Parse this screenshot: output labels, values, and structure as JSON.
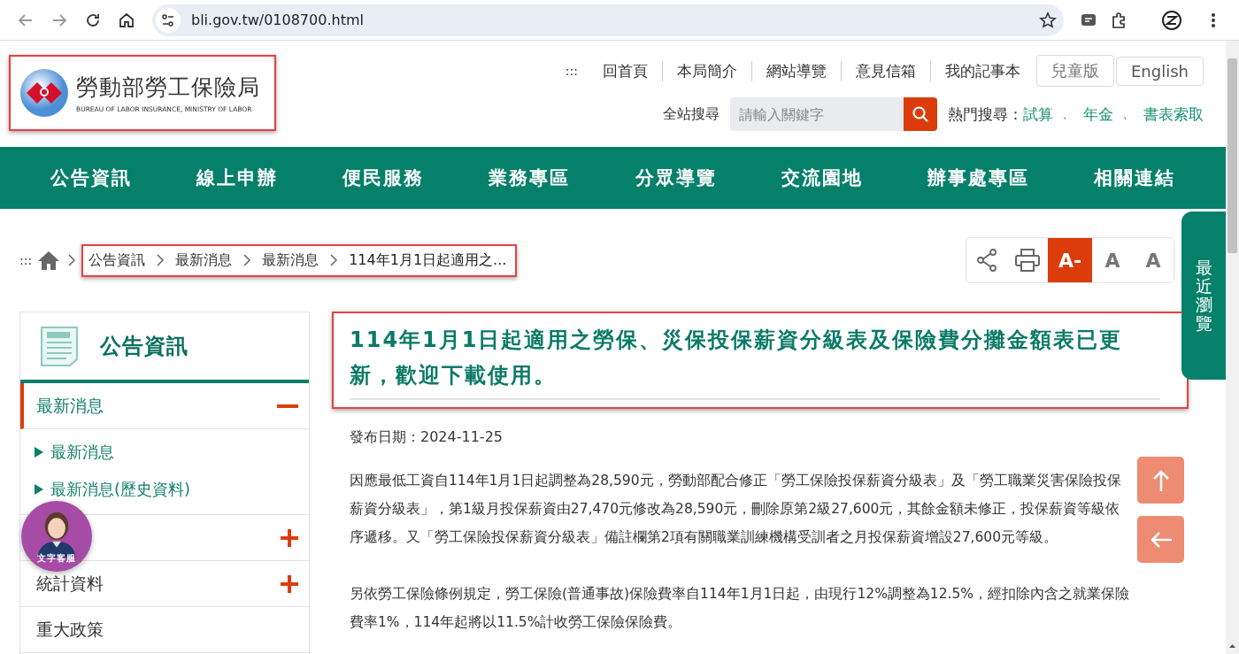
{
  "browser": {
    "url": "bli.gov.tw/0108700.html"
  },
  "logo": {
    "title": "勞動部勞工保險局",
    "subtitle": "BUREAU OF LABOR INSURANCE, MINISTRY OF LABOR"
  },
  "top_links": {
    "accesskey": ":::",
    "items": [
      "回首頁",
      "本局簡介",
      "網站導覽",
      "意見信箱",
      "我的記事本"
    ]
  },
  "top_buttons": [
    "兒童版",
    "English"
  ],
  "search": {
    "label": "全站搜尋",
    "placeholder": "請輸入關鍵字"
  },
  "hot_search": {
    "label": "熱門搜尋：",
    "links": [
      "試算",
      "年金",
      "書表索取"
    ],
    "separators": [
      "、",
      "、"
    ]
  },
  "nav": [
    "公告資訊",
    "線上申辦",
    "便民服務",
    "業務專區",
    "分眾導覽",
    "交流園地",
    "辦事處專區",
    "相關連結"
  ],
  "breadcrumb": {
    "accesskey": ":::",
    "items": [
      "公告資訊",
      "最新消息",
      "最新消息",
      "114年1月1日起適用之..."
    ]
  },
  "tools": [
    {
      "kind": "share"
    },
    {
      "kind": "print"
    },
    {
      "kind": "font",
      "label": "A-",
      "selected": true
    },
    {
      "kind": "font",
      "label": "A",
      "selected": false
    },
    {
      "kind": "font",
      "label": "A",
      "selected": false
    }
  ],
  "recent_tab": "最近瀏覽",
  "sidebar": {
    "title": "公告資訊",
    "items": [
      {
        "label": "最新消息",
        "selected": true,
        "expanded": true,
        "children": [
          {
            "label": "最新消息"
          },
          {
            "label": "最新消息(歷史資料)"
          }
        ]
      },
      {
        "selected": false,
        "expanded": false
      },
      {
        "label": "統計資料",
        "selected": false,
        "expanded": false
      },
      {
        "label": "重大政策",
        "selected": false
      }
    ]
  },
  "article": {
    "title": "114年1月1日起適用之勞保、災保投保薪資分級表及保險費分攤金額表已更新，歡迎下載使用。",
    "date_label": "發布日期：",
    "date": "2024-11-25",
    "paragraphs": [
      "因應最低工資自114年1月1日起調整為28,590元，勞動部配合修正「勞工保險投保薪資分級表」及「勞工職業災害保險投保薪資分級表」，第1級月投保薪資由27,470元修改為28,590元，刪除原第2級27,600元，其餘金額未修正，投保薪資等級依序遞移。又「勞工保險投保薪資分級表」備註欄第2項有關職業訓練機構受訓者之月投保薪資增設27,600元等級。",
      "另依勞工保險條例規定，勞工保險(普通事故)保險費率自114年1月1日起，由現行12%調整為12.5%，經扣除內含之就業保險費率1%，114年起將以11.5%計收勞工保險保險費。"
    ]
  },
  "chat": {
    "label": "文字客服"
  }
}
